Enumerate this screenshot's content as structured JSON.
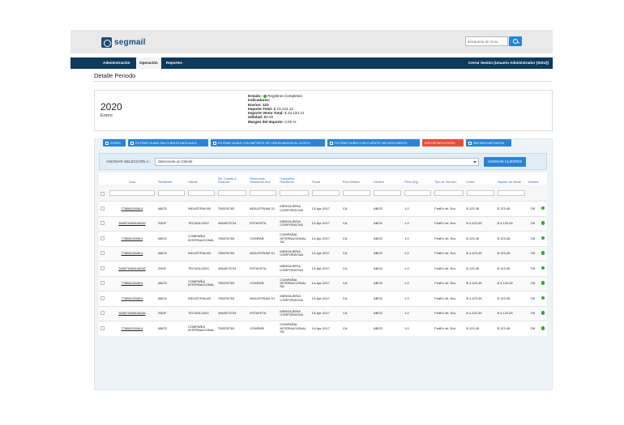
{
  "brand": {
    "name": "segmail"
  },
  "search": {
    "placeholder": "Búsqueda de Guía"
  },
  "nav": {
    "items": [
      {
        "label": "Administración"
      },
      {
        "label": "Operación"
      },
      {
        "label": "Reportes"
      }
    ],
    "session": "Cerrar Sesión (Usuario Administrador (SISU))"
  },
  "page": {
    "title": "Detalle Periodo"
  },
  "summary": {
    "year": "2020",
    "month": "Enero",
    "estado_label": "Estado:",
    "estado_value": "Registros Completos",
    "indicadores_label": "Indicadores:",
    "envios_label": "Envíos:",
    "envios_value": "123",
    "importe_total_label": "Importe Total:",
    "importe_total_value": "$ 23,123.12",
    "importe_venta_label": "Importe Venta Total:",
    "importe_venta_value": "$ 23,123.12",
    "utilidad_label": "Utilidad:",
    "utilidad_value": "$0.00",
    "margen_label": "Margen del Importe:",
    "margen_value": "0.00 %"
  },
  "toolbar": {
    "atras": "ATRÁS",
    "filtro1": "FILTRAR GUÍAS SIN CLIENTE ASOCIADO",
    "filtro2": "FILTRAR GUÍAS CON IMPORTE DE VENTA MENOR AL COSTO",
    "filtro3": "FILTRAR GUÍAS CON CLIENTE SIN DESCUENTO",
    "exportar": "EXPORTAR A EXCEL",
    "refrescar": "REFRESCAR DATOS"
  },
  "assign": {
    "label": "ASIGNAR SELECCIÓN A:",
    "select_value": "Selecciona un Cliente",
    "button": "ASIGNAR CLIENTES"
  },
  "table": {
    "headers": [
      "Guía",
      "Remitente",
      "Cliente",
      "No. Cuenta A Facturar",
      "Referencia Remitente Uno",
      "Compañía Remitente",
      "Fecha",
      "País Destino",
      "Destino",
      "Peso (Kg)",
      "Tipo de Servicio",
      "Costo",
      "Importe de Venta",
      "Estatus"
    ],
    "rows": [
      [
        "778861026814",
        "ABCD",
        "INDUSTRIA MX",
        "758376783",
        "INDUSTRIAM SJ",
        "MENSAJERIA CORPORATIVA",
        "13-Apr-2017",
        "CA",
        "ABCD",
        "1.0",
        "FedEx Int. Eco",
        "$ 123.45",
        "$ 123.45",
        "OK"
      ],
      [
        "345873459446245",
        "SSDF",
        "TECNOLOGIC",
        "4564573734",
        "ESTAFETA",
        "MENSAJERIA CORPORATIVA",
        "13-Apr-2017",
        "CA",
        "ABCD",
        "1.0",
        "FedEx Int. Eco",
        "$ 4,123.45",
        "$ 4,123.45",
        "OK"
      ],
      [
        "778861026814",
        "ABCD",
        "COMPAÑIA INTERNACIONAL",
        "758376783",
        "COMPAÑ",
        "COMPAÑIA INTERNACIONAL SA",
        "14-Apr-2017",
        "CA",
        "ABCD",
        "1.0",
        "FedEx Int. Eco",
        "$ 123.45",
        "$ 123.45",
        "OK"
      ],
      [
        "778861026814",
        "ABCD",
        "INDUSTRIA MX",
        "758376783",
        "INDUSTRIAM SJ",
        "MENSAJERIA CORPORATIVA",
        "13-Apr-2017",
        "CA",
        "ABCD",
        "1.0",
        "FedEx Int. Eco",
        "$ 4,123.45",
        "$ 123.45",
        "OK"
      ],
      [
        "345873459446245",
        "SSDF",
        "TECNOLOGIC",
        "4564573734",
        "ESTAFETA",
        "MENSAJERIA CORPORATIVA",
        "13-Apr-2017",
        "CA",
        "ABCD",
        "1.0",
        "FedEx Int. Eco",
        "$ 123.45",
        "$ 123.45",
        "OK"
      ],
      [
        "778861026814",
        "ABCD",
        "COMPAÑIA INTERNACIONAL",
        "758376783",
        "COMPAÑ",
        "COMPAÑIA INTERNACIONAL SA",
        "14-Apr-2017",
        "CA",
        "ABCD",
        "1.0",
        "FedEx Int. Eco",
        "$ 4,123.45",
        "$ 4,123.45",
        "OK"
      ],
      [
        "778861026814",
        "ABCD",
        "INDUSTRIA MX",
        "758376783",
        "INDUSTRIAM SJ",
        "MENSAJERIA CORPORATIVA",
        "13-Apr-2017",
        "CA",
        "ABCD",
        "1.0",
        "FedEx Int. Eco",
        "$ 4,123.45",
        "$ 123.45",
        "OK"
      ],
      [
        "345873459446245",
        "SSDF",
        "TECNOLOGIC",
        "4564573734",
        "ESTAFETA",
        "MENSAJERIA CORPORATIVA",
        "13-Apr-2017",
        "CA",
        "ABCD",
        "1.0",
        "FedEx Int. Eco",
        "$ 4,123.45",
        "$ 4,123.45",
        "OK"
      ],
      [
        "778861026814",
        "ABCD",
        "COMPAÑIA INTERNACIONAL",
        "758376783",
        "COMPAÑ",
        "COMPAÑIA INTERNACIONAL SA",
        "14-Apr-2017",
        "CA",
        "ABCD",
        "1.0",
        "FedEx Int. Eco",
        "$ 123.45",
        "$ 123.45",
        "OK"
      ]
    ]
  },
  "colors": {
    "accent": "#2a84d6",
    "navbar": "#0e3a5c",
    "danger": "#e74c3c",
    "ok": "#3aa53a"
  }
}
